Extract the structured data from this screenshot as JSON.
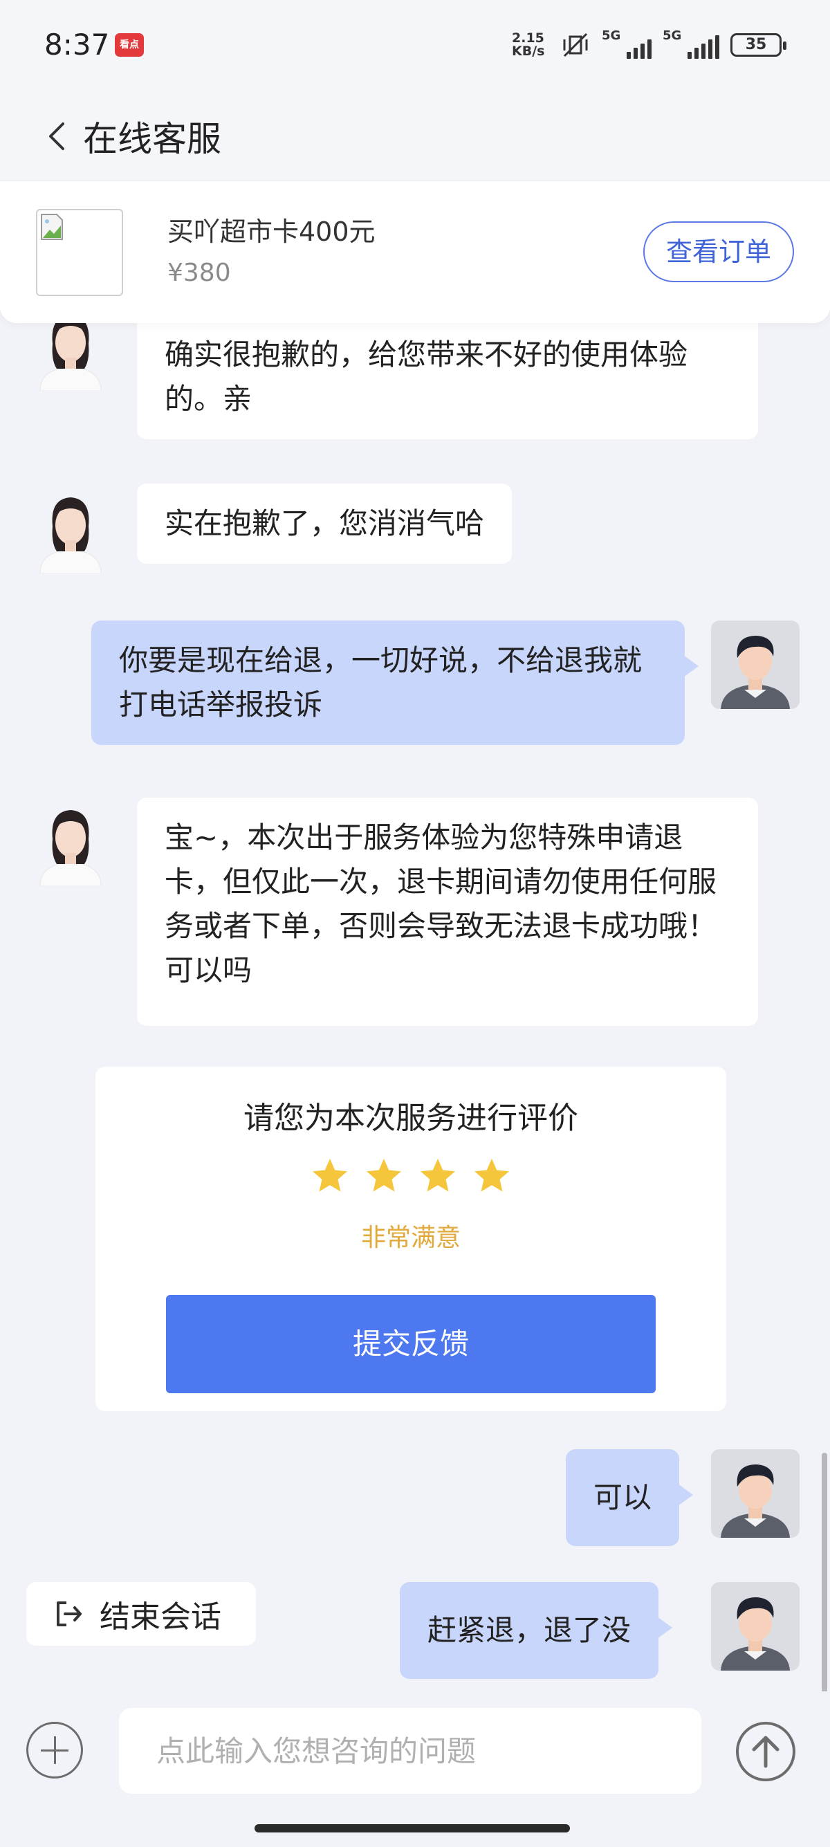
{
  "status_bar": {
    "time": "8:37",
    "app_badge": "看点",
    "net_speed_value": "2.15",
    "net_speed_unit": "KB/s",
    "signal_label_1": "5G",
    "signal_label_2": "5G",
    "battery": "35"
  },
  "header": {
    "title": "在线客服"
  },
  "product": {
    "name": "买吖超市卡400元",
    "price": "¥380",
    "view_order_label": "查看订单"
  },
  "messages": [
    {
      "sender": "agent",
      "text": "确实很抱歉的，给您带来不好的使用体验的。亲"
    },
    {
      "sender": "agent",
      "text": "实在抱歉了，您消消气哈"
    },
    {
      "sender": "user",
      "text": "你要是现在给退，一切好说，不给退我就打电话举报投诉"
    },
    {
      "sender": "agent",
      "text": "宝~，本次出于服务体验为您特殊申请退卡，但仅此一次，退卡期间请勿使用任何服务或者下单，否则会导致无法退卡成功哦！可以吗"
    },
    {
      "sender": "user",
      "text": "可以"
    },
    {
      "sender": "user",
      "text": "赶紧退，退了没"
    }
  ],
  "rating": {
    "title": "请您为本次服务进行评价",
    "stars": 4,
    "label": "非常满意",
    "submit_label": "提交反馈",
    "star_color": "#f5c63c"
  },
  "end_session_label": "结束会话",
  "input": {
    "placeholder": "点此输入您想咨询的问题"
  },
  "colors": {
    "accent": "#4d78f0",
    "user_bubble": "#c9d6fb",
    "rating_text": "#e2a93c"
  }
}
